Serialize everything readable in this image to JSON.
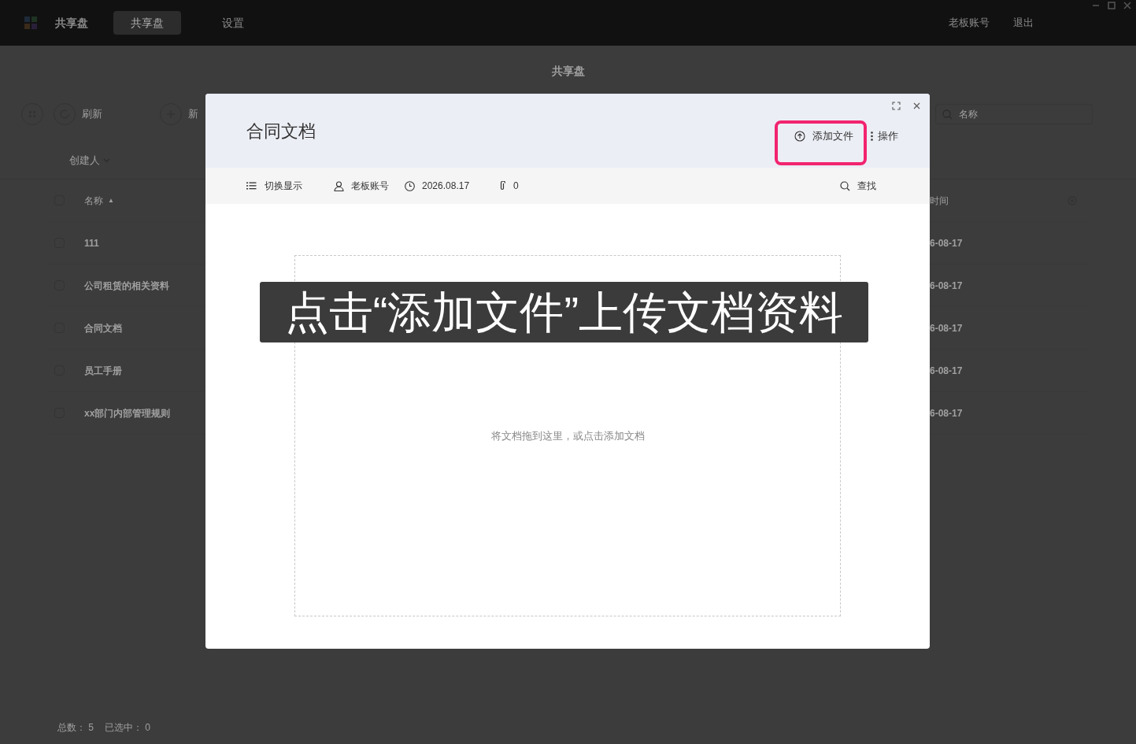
{
  "app": {
    "name": "共享盘",
    "nav": [
      {
        "label": "共享盘",
        "selected": true
      },
      {
        "label": "设置",
        "selected": false
      }
    ],
    "user": "老板账号",
    "logout": "退出"
  },
  "page": {
    "title": "共享盘",
    "toolbar": {
      "refresh": "刷新",
      "create": "新"
    },
    "search": {
      "placeholder": "名称"
    },
    "filter": "创建人",
    "table": {
      "all_checked": false,
      "columns": [
        {
          "label": "名称",
          "sort_mark": "▲"
        },
        {
          "label": "时间"
        }
      ],
      "rows": [
        {
          "name": "111",
          "date": "6-08-17",
          "checked": false
        },
        {
          "name": "公司租赁的相关资料",
          "date": "6-08-17",
          "checked": false
        },
        {
          "name": "合同文档",
          "date": "6-08-17",
          "checked": false
        },
        {
          "name": "员工手册",
          "date": "6-08-17",
          "checked": false
        },
        {
          "name": "xx部门内部管理规则",
          "date": "6-08-17",
          "checked": false
        }
      ]
    },
    "footer": {
      "total_label": "总数：",
      "total": "5",
      "selected_label": "已选中：",
      "selected": "0"
    }
  },
  "dialog": {
    "title": "合同文档",
    "add_button": "添加文件",
    "more_button": "操作",
    "view_toggle": "切换显示",
    "owner": "老板账号",
    "date": "2026.08.17",
    "attachments": "0",
    "find": "查找",
    "drop_hint": "将文档拖到这里，或点击添加文档"
  },
  "caption": "点击“添加文件”上传文档资料"
}
